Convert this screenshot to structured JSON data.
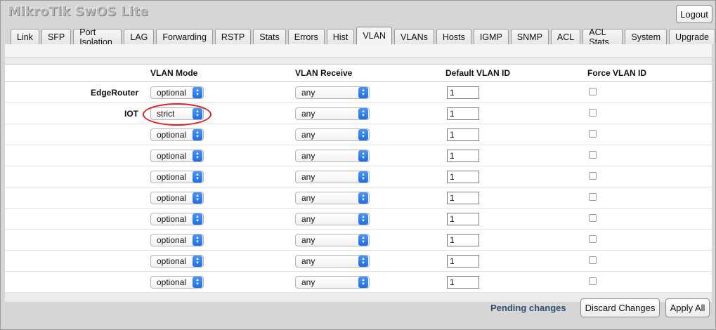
{
  "app": {
    "title": "MikroTik SwOS Lite"
  },
  "header": {
    "logout_label": "Logout"
  },
  "tabs": [
    {
      "label": "Link"
    },
    {
      "label": "SFP"
    },
    {
      "label": "Port Isolation"
    },
    {
      "label": "LAG"
    },
    {
      "label": "Forwarding"
    },
    {
      "label": "RSTP"
    },
    {
      "label": "Stats"
    },
    {
      "label": "Errors"
    },
    {
      "label": "Hist"
    },
    {
      "label": "VLAN",
      "active": true
    },
    {
      "label": "VLANs"
    },
    {
      "label": "Hosts"
    },
    {
      "label": "IGMP"
    },
    {
      "label": "SNMP"
    },
    {
      "label": "ACL"
    },
    {
      "label": "ACL Stats"
    },
    {
      "label": "System"
    },
    {
      "label": "Upgrade"
    }
  ],
  "table": {
    "columns": [
      "VLAN Mode",
      "VLAN Receive",
      "Default VLAN ID",
      "Force VLAN ID"
    ],
    "rows": [
      {
        "name": "EdgeRouter",
        "mode": "optional",
        "receive": "any",
        "default_id": "1",
        "force": false
      },
      {
        "name": "IOT",
        "mode": "strict",
        "receive": "any",
        "default_id": "1",
        "force": false
      },
      {
        "name": "",
        "mode": "optional",
        "receive": "any",
        "default_id": "1",
        "force": false
      },
      {
        "name": "",
        "mode": "optional",
        "receive": "any",
        "default_id": "1",
        "force": false
      },
      {
        "name": "",
        "mode": "optional",
        "receive": "any",
        "default_id": "1",
        "force": false
      },
      {
        "name": "",
        "mode": "optional",
        "receive": "any",
        "default_id": "1",
        "force": false
      },
      {
        "name": "",
        "mode": "optional",
        "receive": "any",
        "default_id": "1",
        "force": false
      },
      {
        "name": "",
        "mode": "optional",
        "receive": "any",
        "default_id": "1",
        "force": false
      },
      {
        "name": "",
        "mode": "optional",
        "receive": "any",
        "default_id": "1",
        "force": false
      },
      {
        "name": "",
        "mode": "optional",
        "receive": "any",
        "default_id": "1",
        "force": false
      }
    ]
  },
  "footer": {
    "pending_text": "Pending changes",
    "discard_label": "Discard Changes",
    "apply_label": "Apply All"
  },
  "colors": {
    "annotation_circle": "#e02020",
    "select_arrow": "#1e6fe0",
    "pending_text": "#2f4f6f"
  }
}
